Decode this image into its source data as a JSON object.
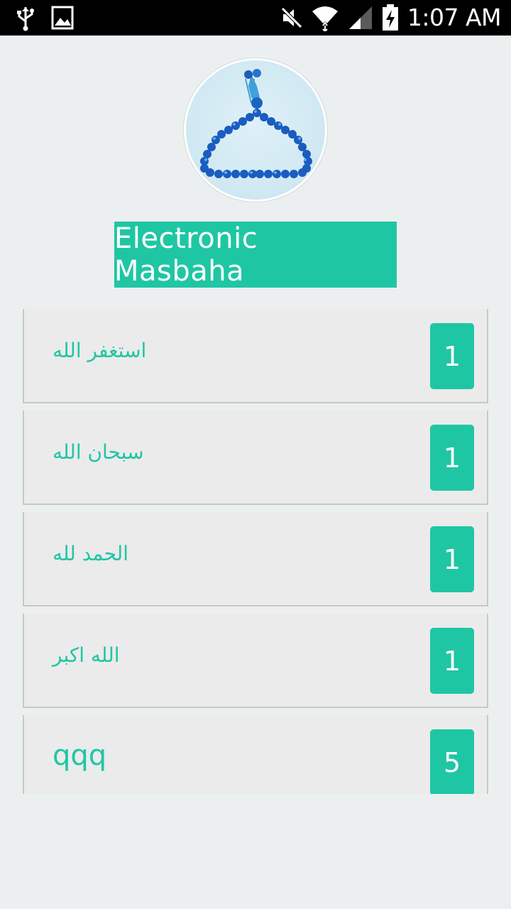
{
  "status_bar": {
    "time": "1:07 AM",
    "icons": [
      "usb-icon",
      "image-icon",
      "mute-icon",
      "wifi-icon",
      "signal-icon",
      "battery-charging-icon"
    ]
  },
  "app": {
    "logo": "prayer-beads-icon",
    "title": "Electronic Masbaha",
    "accent_color": "#1fc6a4"
  },
  "items": [
    {
      "label": "استغفر الله",
      "count": "1"
    },
    {
      "label": "سبحان الله",
      "count": "1"
    },
    {
      "label": "الحمد لله",
      "count": "1"
    },
    {
      "label": "الله اكبر",
      "count": "1"
    },
    {
      "label": "qqq",
      "count": "5"
    }
  ]
}
